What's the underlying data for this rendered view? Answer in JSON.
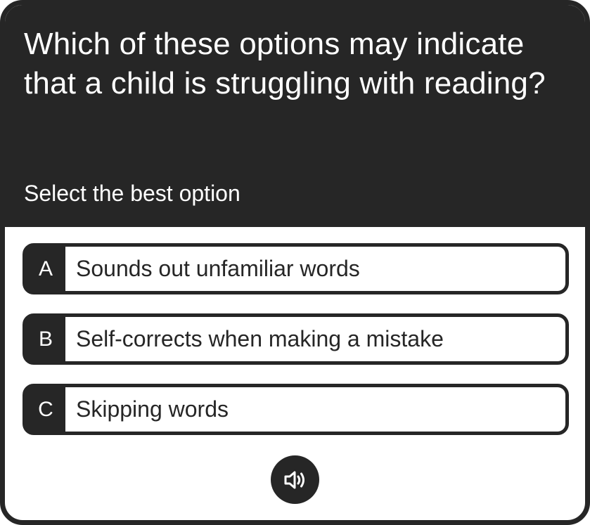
{
  "question": {
    "text": "Which of these options may indicate that a child is struggling with reading?",
    "instruction": "Select the best option"
  },
  "options": [
    {
      "letter": "A",
      "text": "Sounds out unfamiliar words"
    },
    {
      "letter": "B",
      "text": "Self-corrects when making a mistake"
    },
    {
      "letter": "C",
      "text": "Skipping words"
    }
  ],
  "audio": {
    "icon": "speaker-icon"
  },
  "colors": {
    "dark": "#262626",
    "light": "#ffffff"
  }
}
